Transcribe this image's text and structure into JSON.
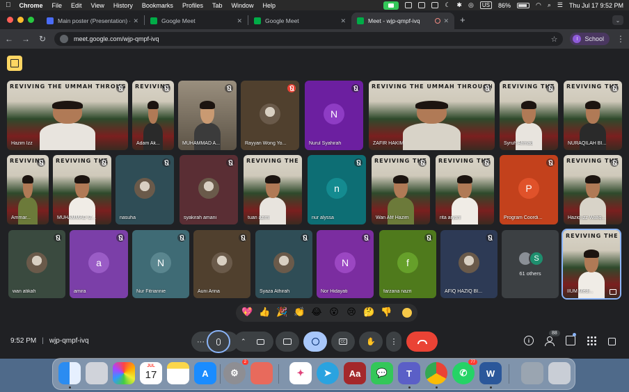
{
  "menubar": {
    "app": "Chrome",
    "items": [
      "File",
      "Edit",
      "View",
      "History",
      "Bookmarks",
      "Profiles",
      "Tab",
      "Window",
      "Help"
    ],
    "input_source": "US",
    "battery": "86%",
    "clock": "Thu Jul 17  9:52 PM"
  },
  "tabs": [
    {
      "title": "Main poster (Presentation) - ",
      "fav_color": "#4a6cf7"
    },
    {
      "title": "Google Meet",
      "fav_color": "#00ac47"
    },
    {
      "title": "Google Meet",
      "fav_color": "#00ac47"
    },
    {
      "title": "Meet - wjp-qmpf-ivq",
      "fav_color": "#00ac47"
    }
  ],
  "toolbar": {
    "url": "meet.google.com/wjp-qmpf-ivq",
    "profile_label": "School",
    "profile_initial": "I"
  },
  "tiles": [
    {
      "name": "Hazim Izz",
      "kind": "banner",
      "muted": "dark"
    },
    {
      "name": "Adam Ak...",
      "kind": "banner",
      "muted": "dark"
    },
    {
      "name": "MUHAMMAD A...",
      "kind": "camera",
      "muted": "dark"
    },
    {
      "name": "Rayyan Wong Yo...",
      "kind": "photo",
      "muted": "red"
    },
    {
      "name": "Nurul Syahirah",
      "kind": "letter",
      "letter": "N",
      "muted": "dark"
    },
    {
      "name": "ZAFIR HAKIM",
      "kind": "banner",
      "muted": "dark"
    },
    {
      "name": "Syruh Ahmad",
      "kind": "banner",
      "muted": "dark"
    },
    {
      "name": "NURAQILAH BI...",
      "kind": "banner",
      "muted": "dark"
    },
    {
      "name": "Ammar...",
      "kind": "banner",
      "muted": "dark"
    },
    {
      "name": "MUHAMMAD IZ...",
      "kind": "banner",
      "muted": "dark"
    },
    {
      "name": "nasuha",
      "kind": "photo",
      "muted": "dark"
    },
    {
      "name": "syakirah amani",
      "kind": "photo",
      "muted": "dark"
    },
    {
      "name": "tuan azimi",
      "kind": "banner",
      "muted": "none"
    },
    {
      "name": "nur alyssa",
      "kind": "letter",
      "letter": "n",
      "muted": "dark"
    },
    {
      "name": "Wan Afif Hazim",
      "kind": "banner",
      "muted": "dark"
    },
    {
      "name": "rita aryani",
      "kind": "banner",
      "muted": "dark"
    },
    {
      "name": "Program Coordi...",
      "kind": "letter",
      "letter": "P",
      "muted": "dark"
    },
    {
      "name": "Haziq Izz Wafiq...",
      "kind": "banner",
      "muted": "dark"
    },
    {
      "name": "wan atikah",
      "kind": "photo",
      "muted": "dark"
    },
    {
      "name": "amira",
      "kind": "letter",
      "letter": "a",
      "muted": "dark"
    },
    {
      "name": "Nur Fitriannie",
      "kind": "letter",
      "letter": "N",
      "muted": "dark"
    },
    {
      "name": "Auni Arina",
      "kind": "photo",
      "muted": "dark"
    },
    {
      "name": "Syaza Athirah",
      "kind": "photo",
      "muted": "dark"
    },
    {
      "name": "Nor Hidayati",
      "kind": "letter",
      "letter": "N",
      "muted": "dark"
    },
    {
      "name": "farzana nazri",
      "kind": "letter",
      "letter": "f",
      "muted": "dark"
    },
    {
      "name": "AFIQ HAZIQ BI...",
      "kind": "photo",
      "muted": "dark"
    },
    {
      "name": "61 others",
      "kind": "others",
      "muted": "none"
    },
    {
      "name": "IIUM Medi...",
      "kind": "banner",
      "muted": "none"
    }
  ],
  "banner_text": "REVIVING THE UMMAH THROUGH INTELLECTUAL SOLIDARITY",
  "others_initial": "S",
  "reactions": [
    "💖",
    "👍",
    "🎉",
    "👏",
    "😂",
    "😮",
    "😢",
    "🤔",
    "👎"
  ],
  "controls": {
    "time": "9:52 PM",
    "meeting_code": "wjp-qmpf-ivq",
    "people_count": "88"
  },
  "dock": {
    "calendar_month": "JUL",
    "calendar_day": "17",
    "settings_badge": "2",
    "whatsapp_badge": "77",
    "dictionary_label": "Aa"
  }
}
